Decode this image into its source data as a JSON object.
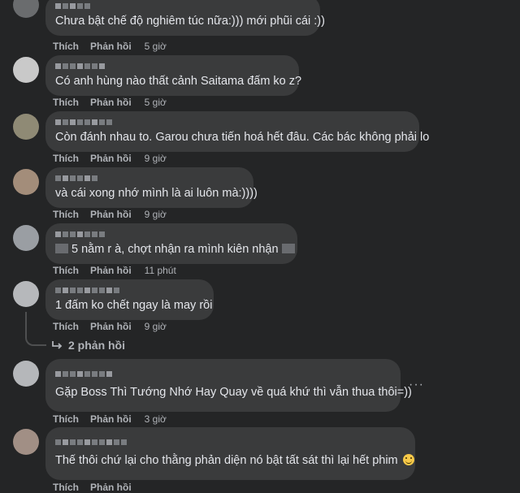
{
  "comments": [
    {
      "text": "Chưa bật chế độ nghiêm túc nữa:))) mới phũi cái :))",
      "like": "Thích",
      "reply": "Phản hồi",
      "time": "5 giờ"
    },
    {
      "text": "Có anh hùng nào thất cảnh Saitama đấm ko z?",
      "like": "Thích",
      "reply": "Phản hồi",
      "time": "5 giờ"
    },
    {
      "text": "Còn đánh nhau to. Garou chưa tiến hoá hết đâu. Các bác không phải lo",
      "like": "Thích",
      "reply": "Phản hồi",
      "time": "9 giờ"
    },
    {
      "text": "và cái xong nhớ mình là ai luôn mà:))))",
      "like": "Thích",
      "reply": "Phản hồi",
      "time": "9 giờ"
    },
    {
      "text": "5 nằm r à, chợt nhận ra mình kiên nhận",
      "like": "Thích",
      "reply": "Phản hồi",
      "time": "11 phút"
    },
    {
      "text": "1 đấm ko chết ngay là may rồi",
      "like": "Thích",
      "reply": "Phản hồi",
      "time": "9 giờ"
    },
    {
      "text": "Gặp Boss Thì Tướng Nhớ Hay Quay về quá khứ thì vẫn thua thôi=))",
      "like": "Thích",
      "reply": "Phản hồi",
      "time": "3 giờ"
    },
    {
      "text": "Thế thôi chứ lại cho thằng phản diện nó bật tất sát thì lại hết phim",
      "like": "Thích",
      "reply": "Phản hồi",
      "time": ""
    }
  ],
  "replies_link": "2 phản hồi",
  "more_menu": "···",
  "colors": {
    "background": "#242526",
    "bubble": "#3a3b3c",
    "text": "#e4e6eb",
    "secondary": "#b0b3b8"
  }
}
